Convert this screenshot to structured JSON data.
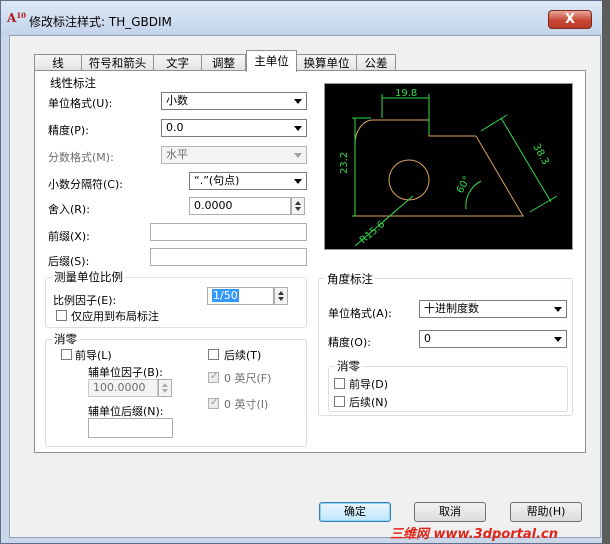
{
  "window": {
    "app_icon_text": "A",
    "app_icon_sub": "10",
    "title": "修改标注样式: TH_GBDIM",
    "close_label": "X"
  },
  "tabs": [
    {
      "label": "线",
      "active": false
    },
    {
      "label": "符号和箭头",
      "active": false
    },
    {
      "label": "文字",
      "active": false
    },
    {
      "label": "调整",
      "active": false
    },
    {
      "label": "主单位",
      "active": true
    },
    {
      "label": "换算单位",
      "active": false
    },
    {
      "label": "公差",
      "active": false
    }
  ],
  "linear": {
    "title": "线性标注",
    "unit_format_label": "单位格式(U):",
    "unit_format_value": "小数",
    "precision_label": "精度(P):",
    "precision_value": "0.0",
    "fraction_format_label": "分数格式(M):",
    "fraction_format_value": "水平",
    "decimal_sep_label": "小数分隔符(C):",
    "decimal_sep_value": "“.”(句点)",
    "round_off_label": "舍入(R):",
    "round_off_value": "0.0000",
    "prefix_label": "前缀(X):",
    "prefix_value": "",
    "suffix_label": "后缀(S):",
    "suffix_value": ""
  },
  "scale": {
    "title": "测量单位比例",
    "factor_label": "比例因子(E):",
    "factor_value": "1/50",
    "layout_only_label": "仅应用到布局标注",
    "layout_only_checked": false
  },
  "zero_linear": {
    "title": "消零",
    "leading_label": "前导(L)",
    "leading_checked": false,
    "sub_factor_label": "辅单位因子(B):",
    "sub_factor_value": "100.0000",
    "sub_suffix_label": "辅单位后缀(N):",
    "sub_suffix_value": "",
    "trailing_label": "后续(T)",
    "trailing_checked": false,
    "feet_label": "0 英尺(F)",
    "feet_checked": true,
    "inches_label": "0 英寸(I)",
    "inches_checked": true,
    "check_glyph": "✓"
  },
  "preview": {
    "dim_top": "19.8",
    "dim_left": "23.2",
    "dim_right": "38.3",
    "dim_angle": "60°",
    "dim_radius": "R15.6"
  },
  "angular": {
    "title": "角度标注",
    "unit_format_label": "单位格式(A):",
    "unit_format_value": "十进制度数",
    "precision_label": "精度(O):",
    "precision_value": "0",
    "zero_title": "消零",
    "leading_label": "前导(D)",
    "leading_checked": false,
    "trailing_label": "后续(N)",
    "trailing_checked": false
  },
  "buttons": {
    "ok": "确定",
    "cancel": "取消",
    "help": "帮助(H)"
  },
  "watermark": "三维网 www.3dportal.cn",
  "colors": {
    "preview_bg": "#000000",
    "preview_geometry": "#d8a35a",
    "preview_dims": "#2fdc4a",
    "selection": "#3399ff"
  }
}
